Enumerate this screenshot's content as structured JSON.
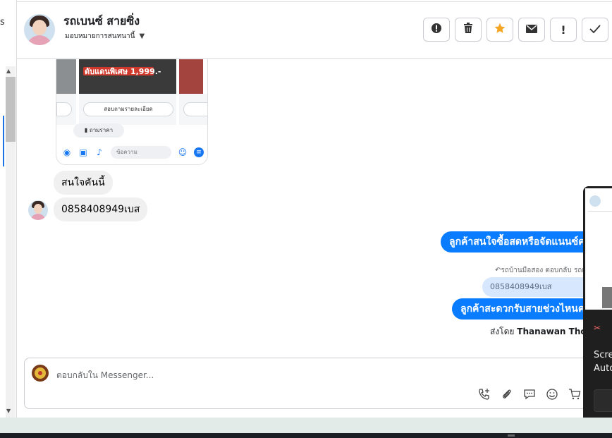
{
  "left_panel": {
    "cut_text": "s"
  },
  "header": {
    "contact_name": "รถเบนซ์ สายซิ่ง",
    "assign_label": "มอบหมายการสนทนานี้",
    "actions": [
      {
        "name": "spam",
        "icon": "exclamation-circle-icon",
        "glyph": "!"
      },
      {
        "name": "trash",
        "icon": "trash-icon",
        "glyph": "🗑"
      },
      {
        "name": "star",
        "icon": "star-icon",
        "glyph": "★"
      },
      {
        "name": "mail",
        "icon": "envelope-icon",
        "glyph": "✉"
      },
      {
        "name": "alert",
        "icon": "exclamation-icon",
        "glyph": "!"
      },
      {
        "name": "done",
        "icon": "check-icon",
        "glyph": "✓"
      }
    ]
  },
  "preview": {
    "price_text": "ดับแดนพิเศษ 1,999.-",
    "details_button": "สอบถามรายละเอียด",
    "ask_price_button": "ถามราคา",
    "input_placeholder": "ข้อความ"
  },
  "messages": {
    "incoming": [
      {
        "text": "สนใจคันนี้"
      },
      {
        "text": "0858408949เบส"
      }
    ],
    "outgoing_1": "ลูกค้าสนใจซื้อสดหรือจัดแนนซ์คะ",
    "reply_meta": "รถบ้านมือสอง ตอบกลับ รถเบ",
    "quoted_text": "0858408949เบส",
    "outgoing_2": "ลูกค้าสะดวกรับสายช่วงไหนคะ",
    "sent_by_prefix": "ส่งโดย",
    "sent_by_name": "Thanawan Thon"
  },
  "composer": {
    "placeholder": "ตอบกลับใน Messenger...",
    "tools": [
      {
        "name": "call",
        "icon": "phone-plus-icon",
        "glyph": "☏"
      },
      {
        "name": "attach",
        "icon": "paperclip-icon",
        "glyph": "⚲"
      },
      {
        "name": "saved-reply",
        "icon": "speech-bubble-icon",
        "glyph": "💬"
      },
      {
        "name": "emoji",
        "icon": "smiley-icon",
        "glyph": "☺"
      },
      {
        "name": "cart",
        "icon": "cart-icon",
        "glyph": "🛒"
      }
    ]
  },
  "popup": {
    "line1": "Scre",
    "line2": "Auto"
  },
  "colors": {
    "accent_blue": "#0a7cff",
    "quoted_bg": "#d7e7fd",
    "incoming_bg": "#f0f0f0",
    "star": "#f5a623"
  }
}
